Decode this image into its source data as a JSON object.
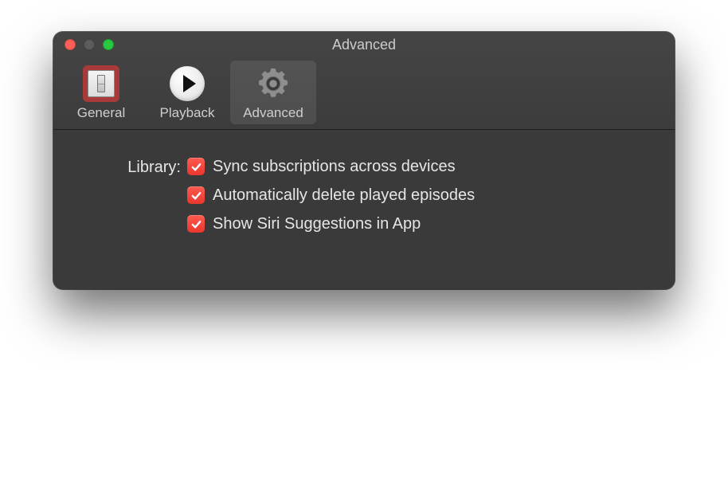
{
  "window": {
    "title": "Advanced"
  },
  "toolbar": {
    "items": [
      {
        "label": "General"
      },
      {
        "label": "Playback"
      },
      {
        "label": "Advanced"
      }
    ],
    "selected_index": 2
  },
  "settings": {
    "section_label": "Library:",
    "options": [
      {
        "label": "Sync subscriptions across devices",
        "checked": true
      },
      {
        "label": "Automatically delete played episodes",
        "checked": true
      },
      {
        "label": "Show Siri Suggestions in App",
        "checked": true
      }
    ]
  }
}
